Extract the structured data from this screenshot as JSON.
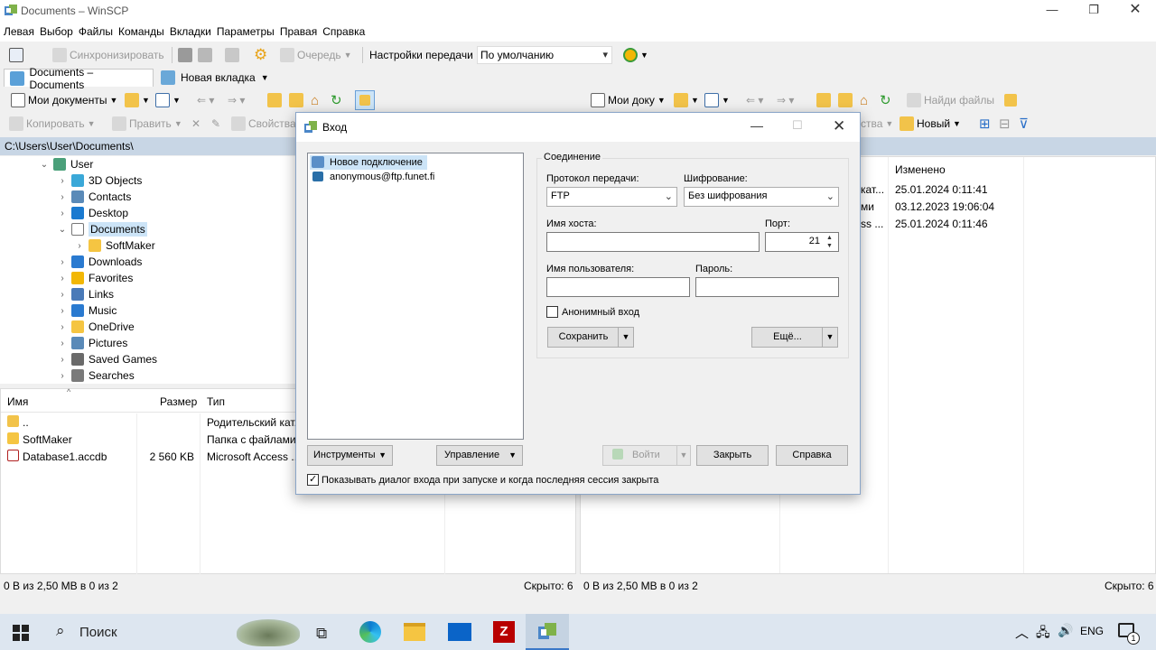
{
  "window": {
    "title": "Documents – WinSCP"
  },
  "menu": [
    "Левая",
    "Выбор",
    "Файлы",
    "Команды",
    "Вкладки",
    "Параметры",
    "Правая",
    "Справка"
  ],
  "toolbar": {
    "sync_label": "Синхронизировать",
    "queue_label": "Очередь",
    "transfer_settings_label": "Настройки передачи",
    "transfer_preset": "По умолчанию"
  },
  "tabs": [
    {
      "label": "Documents – Documents"
    },
    {
      "label": "Новая вкладка"
    }
  ],
  "left_toolbar": {
    "location": "Мои документы"
  },
  "right_toolbar": {
    "location": "Мои доку",
    "find_files": "Найди файлы"
  },
  "left_actions": {
    "copy": "Копировать",
    "edit": "Править",
    "properties": "Свойства"
  },
  "right_actions": {
    "properties_tail": "ства",
    "new": "Новый"
  },
  "path": "C:\\Users\\User\\Documents\\",
  "tree": [
    {
      "label": "User",
      "level": 0,
      "expanded": true,
      "icon": "user-icon"
    },
    {
      "label": "3D Objects",
      "level": 1,
      "icon": "3d-objects-icon"
    },
    {
      "label": "Contacts",
      "level": 1,
      "icon": "contacts-icon"
    },
    {
      "label": "Desktop",
      "level": 1,
      "icon": "desktop-icon"
    },
    {
      "label": "Documents",
      "level": 1,
      "expanded": true,
      "selected": true,
      "icon": "documents-icon"
    },
    {
      "label": "SoftMaker",
      "level": 2,
      "icon": "folder-icon"
    },
    {
      "label": "Downloads",
      "level": 1,
      "icon": "downloads-icon"
    },
    {
      "label": "Favorites",
      "level": 1,
      "icon": "favorites-icon"
    },
    {
      "label": "Links",
      "level": 1,
      "icon": "links-icon"
    },
    {
      "label": "Music",
      "level": 1,
      "icon": "music-icon"
    },
    {
      "label": "OneDrive",
      "level": 1,
      "icon": "folder-icon"
    },
    {
      "label": "Pictures",
      "level": 1,
      "icon": "pictures-icon"
    },
    {
      "label": "Saved Games",
      "level": 1,
      "icon": "saved-games-icon"
    },
    {
      "label": "Searches",
      "level": 1,
      "icon": "searches-icon"
    }
  ],
  "left_list": {
    "columns": [
      "Имя",
      "Размер",
      "Тип"
    ],
    "rows": [
      {
        "name": "..",
        "size": "",
        "type": "Родительский кат..."
      },
      {
        "name": "SoftMaker",
        "size": "",
        "type": "Папка с файлами"
      },
      {
        "name": "Database1.accdb",
        "size": "2 560 KB",
        "type": "Microsoft Access ..."
      }
    ]
  },
  "right_list": {
    "columns": [
      "Изменено"
    ],
    "rows": [
      {
        "type_tail": "кат...",
        "modified": "25.01.2024 0:11:41"
      },
      {
        "type_tail": "ми",
        "modified": "03.12.2023 19:06:04"
      },
      {
        "type_tail": "ss ...",
        "modified": "25.01.2024 0:11:46"
      }
    ]
  },
  "status": {
    "left": "0 В из 2,50 МВ в 0 из 2",
    "left_hidden": "Скрыто: 6",
    "right": "0 В из 2,50 МВ в 0 из 2",
    "right_hidden": "Скрыто: 6"
  },
  "dialog": {
    "title": "Вход",
    "sites": [
      {
        "label": "Новое подключение",
        "selected": true
      },
      {
        "label": "anonymous@ftp.funet.fi"
      }
    ],
    "group_label": "Соединение",
    "protocol_label": "Протокол передачи:",
    "protocol_value": "FTP",
    "encryption_label": "Шифрование:",
    "encryption_value": "Без шифрования",
    "host_label": "Имя хоста:",
    "host_value": "",
    "port_label": "Порт:",
    "port_value": "21",
    "user_label": "Имя пользователя:",
    "user_value": "",
    "password_label": "Пароль:",
    "password_value": "",
    "anonymous_label": "Анонимный вход",
    "save_button": "Сохранить",
    "more_button": "Ещё...",
    "tools_button": "Инструменты",
    "manage_button": "Управление",
    "login_button": "Войти",
    "close_button": "Закрыть",
    "help_button": "Справка",
    "show_on_start_label": "Показывать диалог входа при запуске и когда последняя сессия закрыта"
  },
  "taskbar": {
    "search_placeholder": "Поиск",
    "lang": "ENG",
    "notification_count": "1"
  }
}
